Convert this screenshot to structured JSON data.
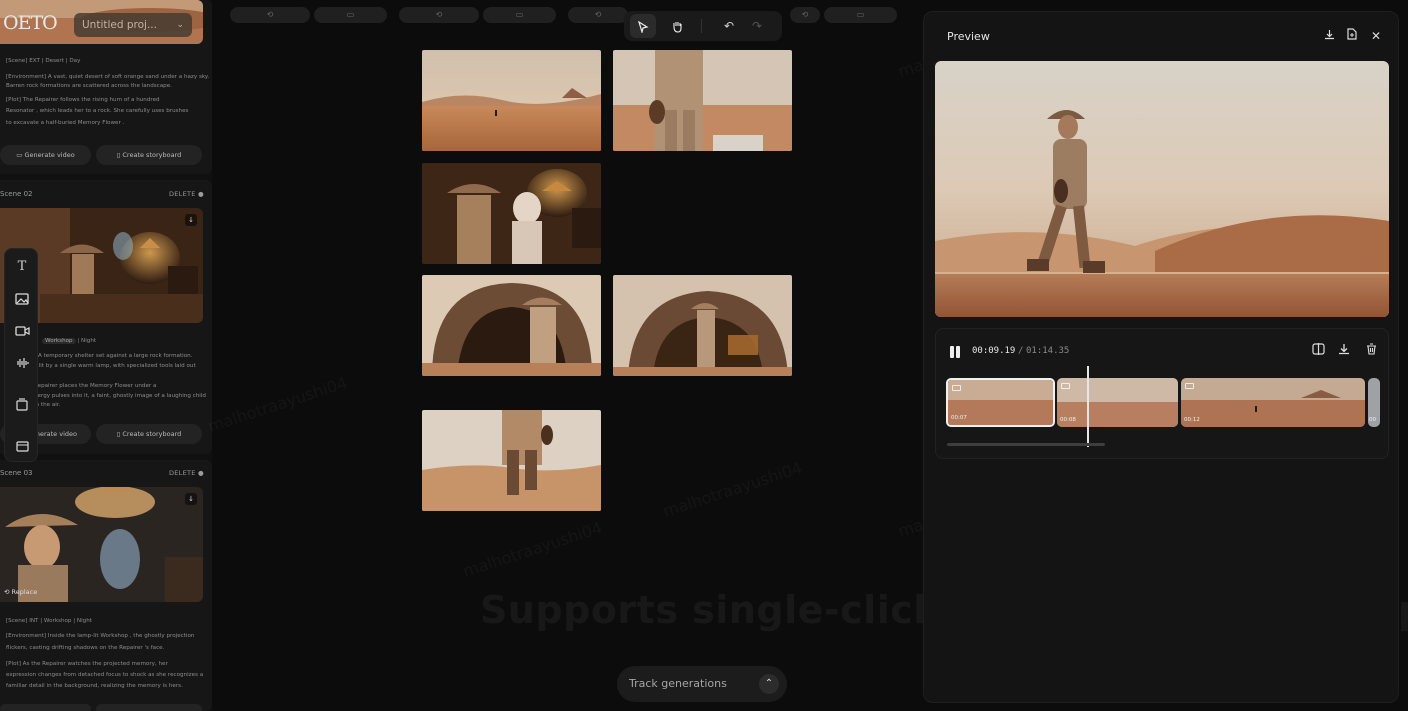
{
  "app": {
    "logo": "OETO",
    "project_name": "Untitled proj...",
    "project_chevron": "chevron-down-icon"
  },
  "scenes": [
    {
      "label": "",
      "lines": [
        "[Scene] EXT | Desert | Day",
        "[Environment] A vast, quiet desert of soft orange sand under a hazy sky.",
        "Barren rock formations are scattered across the landscape.",
        "[Plot] The  Repairer  follows the rising hum of a hundred",
        " Resonator , which leads her to a rock. She carefully uses brushes",
        "to excavate a half-buried  Memory Flower ."
      ],
      "generate_video": "Generate video",
      "create_storyboard": "Create storyboard"
    },
    {
      "label": "Scene 02",
      "delete": "DELETE",
      "tag": "Workshop",
      "tag_suffix": "| Night",
      "lines": [
        "] A temporary shelter set against a large rock formation.",
        "s lit by a single warm lamp, with specialized tools laid out",
        " Repairer  places the  Memory Flower  under a",
        "nergy pulses into it, a faint, ghostly image of a laughing child",
        "in the air."
      ],
      "generate_video": "Generate video",
      "create_storyboard": "Create storyboard"
    },
    {
      "label": "Scene 03",
      "delete": "DELETE",
      "replace": "Replace",
      "lines": [
        "[Scene] INT |  Workshop  | Night",
        "[Environment] Inside the lamp-lit  Workshop , the ghostly projection",
        "flickers, casting drifting shadows on the  Repairer 's face.",
        "[Plot] As the  Repairer  watches the projected memory, her",
        "expression changes from detached focus to shock as she recognizes a",
        "familiar detail in the background, realizing the memory is hers."
      ]
    }
  ],
  "toolstrip": [
    "text-tool-icon",
    "image-tool-icon",
    "video-tool-icon",
    "audio-tool-icon",
    "template-tool-icon",
    "layers-tool-icon"
  ],
  "toolbar": {
    "select": "cursor-icon",
    "pan": "hand-icon",
    "undo": "undo-icon",
    "redo": "redo-icon"
  },
  "canvas": {
    "track_label": "Track generations",
    "track_icon": "chevron-up-icon",
    "overlay_caption": "Supports single-click import and batch import",
    "watermark": "malhotraayushi04"
  },
  "preview": {
    "title": "Preview",
    "current_time": "00:09.19",
    "separator": "/",
    "total_time": "01:14.35",
    "clips": [
      {
        "duration": "00:07",
        "selected": true
      },
      {
        "duration": "00:08",
        "selected": false
      },
      {
        "duration": "00:12",
        "selected": false
      },
      {
        "duration": "00",
        "selected": false
      }
    ]
  }
}
